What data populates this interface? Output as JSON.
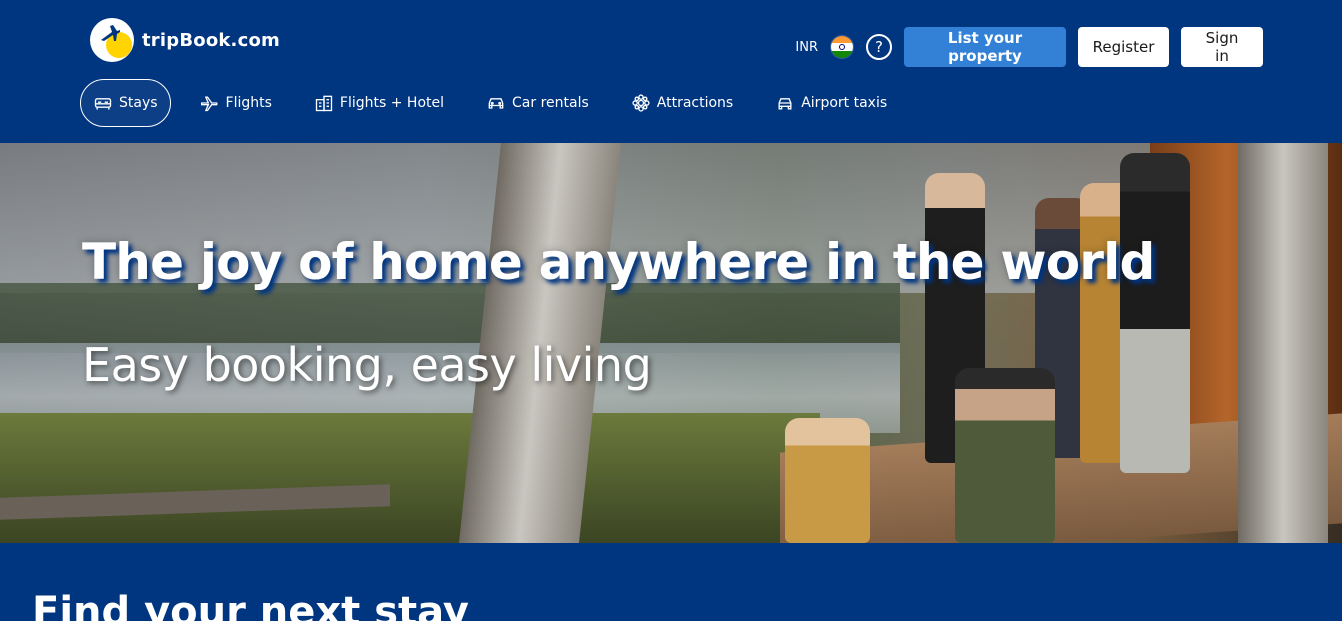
{
  "header": {
    "logo_text": "tripBook.com",
    "currency": "INR",
    "help_glyph": "?",
    "list_property": "List your property",
    "register": "Register",
    "sign_in": "Sign in"
  },
  "nav": {
    "items": [
      {
        "label": "Stays",
        "icon": "bed-icon",
        "active": true
      },
      {
        "label": "Flights",
        "icon": "plane-icon",
        "active": false
      },
      {
        "label": "Flights + Hotel",
        "icon": "flight-hotel-icon",
        "active": false
      },
      {
        "label": "Car rentals",
        "icon": "car-icon",
        "active": false
      },
      {
        "label": "Attractions",
        "icon": "attractions-icon",
        "active": false
      },
      {
        "label": "Airport taxis",
        "icon": "taxi-icon",
        "active": false
      }
    ]
  },
  "hero": {
    "title": "The joy of home anywhere in the world",
    "subtitle": "Easy booking, easy living"
  },
  "search_section": {
    "title": "Find your next stay"
  },
  "colors": {
    "brand_blue": "#003580",
    "button_blue": "#3381d6",
    "logo_yellow": "#ffd400"
  }
}
